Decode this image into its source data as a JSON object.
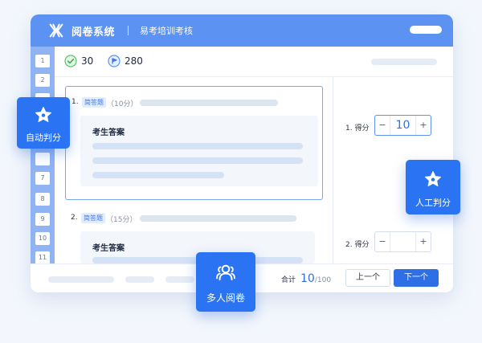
{
  "header": {
    "app_title": "阅卷系统",
    "sub_title": "易考培训考核"
  },
  "sidebar": {
    "numbers": [
      "1",
      "2",
      "6",
      "7",
      "8",
      "9",
      "10",
      "11"
    ]
  },
  "stats": {
    "correct_count": "30",
    "flag_count": "280"
  },
  "questions": [
    {
      "number": "1.",
      "tag": "简答题",
      "score_text": "（10分）",
      "answer_title": "考生答案"
    },
    {
      "number": "2.",
      "tag": "简答题",
      "score_text": "（15分）",
      "answer_title": "考生答案"
    }
  ],
  "grading": [
    {
      "label": "1. 得分",
      "minus": "−",
      "value": "10",
      "plus": "+"
    },
    {
      "label": "2. 得分",
      "minus": "−",
      "value": "",
      "plus": "+"
    }
  ],
  "footer": {
    "total_label": "合计",
    "total_value": "10",
    "total_max": "/100",
    "prev_label": "上一个",
    "next_label": "下一个"
  },
  "badges": {
    "auto": "自动判分",
    "manual": "人工判分",
    "multi": "多人阅卷"
  },
  "colors": {
    "header": "#5c93f2",
    "accent": "#2f6fe6",
    "badge": "#2a74f4",
    "sidebar": "#8fb3f3"
  },
  "icons": {
    "logo": "x-logo-icon",
    "correct": "check-circle-icon",
    "flag": "flag-circle-icon",
    "auto": "star-icon",
    "manual": "star-icon",
    "multi": "users-icon"
  }
}
